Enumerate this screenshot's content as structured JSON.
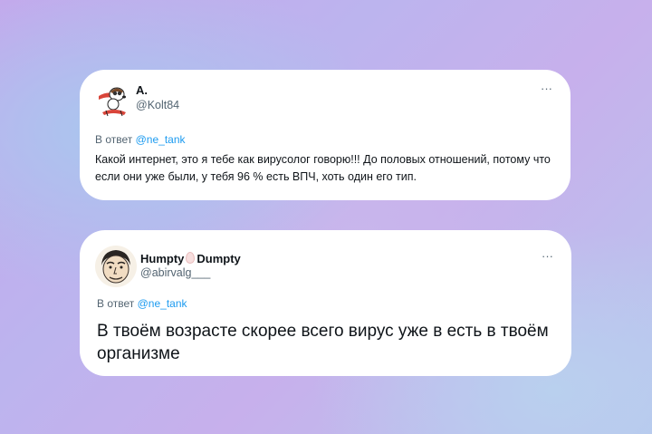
{
  "tweets": [
    {
      "avatar": "snoopy-pilot-avatar",
      "name": "A.",
      "handle": "@Kolt84",
      "reply_prefix": "В ответ",
      "reply_to": "@ne_tank",
      "text": "Какой интернет, это я тебе как вирусолог говорю!!! До половых отношений, потому что если они уже были, у тебя 96 % есть ВПЧ, хоть один его тип.",
      "more": "···"
    },
    {
      "avatar": "caricature-face-avatar",
      "name_part1": "Humpty",
      "name_emoji": "egg-icon",
      "name_part2": "Dumpty",
      "handle": "@abirvalg___",
      "reply_prefix": "В ответ",
      "reply_to": "@ne_tank",
      "text": "В твоём возрасте скорее всего вирус уже в есть в твоём организме",
      "more": "···"
    }
  ]
}
